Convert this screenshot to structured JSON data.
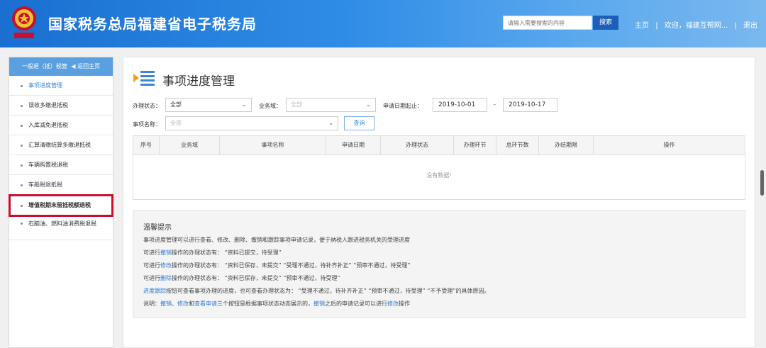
{
  "header": {
    "title": "国家税务总局福建省电子税务局",
    "search_placeholder": "请输入需要搜索的内容",
    "search_button": "搜索",
    "link_home": "主页",
    "welcome": "欢迎，福建互帮网...",
    "logout": "退出",
    "sep": "|"
  },
  "sidebar": {
    "head_label": "一般退（抵）税管",
    "back_label": "返回主页",
    "items": [
      {
        "label": "事项进度管理"
      },
      {
        "label": "误收多缴退抵税"
      },
      {
        "label": "入库减免退抵税"
      },
      {
        "label": "汇算清缴结算多缴退抵税"
      },
      {
        "label": "车辆购置税退税"
      },
      {
        "label": "车船税退抵税"
      },
      {
        "label": "增值税期末留抵税额退税"
      },
      {
        "label": "石脑油、燃料油消费税退税"
      }
    ]
  },
  "main": {
    "title": "事项进度管理",
    "filters": {
      "status_label": "办理状态：",
      "status_value": "全部",
      "domain_label": "业务域：",
      "domain_value": "全部",
      "date_label": "申请日期起止：",
      "date_start": "2019-10-01",
      "date_dash": "-",
      "date_end": "2019-10-17",
      "name_label": "事项名称：",
      "name_value": "全部",
      "query_button": "查询"
    },
    "table": {
      "columns": [
        "序号",
        "业务域",
        "事项名称",
        "申请日期",
        "办理状态",
        "办理环节",
        "总环节数",
        "办结期限",
        "操作"
      ],
      "empty_text": "没有数据!"
    },
    "tips": {
      "title": "温馨提示",
      "line1": "事项进度管理可以进行查看、修改、删除、撤销和跟踪事项申请记录，便于纳税人跟进税务机关的受理进度",
      "line2_pre": "可进行",
      "line2_kw": "撤销",
      "line2_post": "操作的办理状态有：  “资料已提交，待受理”",
      "line3_pre": "可进行",
      "line3_kw": "修改",
      "line3_post": "操作的办理状态有：  “资料已保存，未提交”  “受理不通过，待补齐补正”  “预审不通过，待受理”",
      "line4_pre": "可进行",
      "line4_kw": "删除",
      "line4_post": "操作的办理状态有：  “资料已保存，未提交”  “预审不通过，待受理”",
      "line5_kw": "进度跟踪",
      "line5_post": "按钮可查看事项办理的进度，也可查看办理状态为：  “受理不通过，待补齐补正”  “预审不通过，待受理”  “不予受理”的具体原因。",
      "line6_pre": "说明：",
      "line6_kw1": "撤销",
      "line6_sep": "、",
      "line6_kw2": "修改",
      "line6_and": "和",
      "line6_kw3": "查看申请",
      "line6_mid": "三个按钮是根据事项状态动态展示的，",
      "line6_kw4": "撤销",
      "line6_mid2": "之后的申请记录可以进行",
      "line6_kw5": "修改",
      "line6_end": "操作"
    }
  },
  "colors": {
    "header_blue": "#1a6fd0",
    "accent_blue": "#3b86d6",
    "highlight_red": "#c8102e"
  }
}
